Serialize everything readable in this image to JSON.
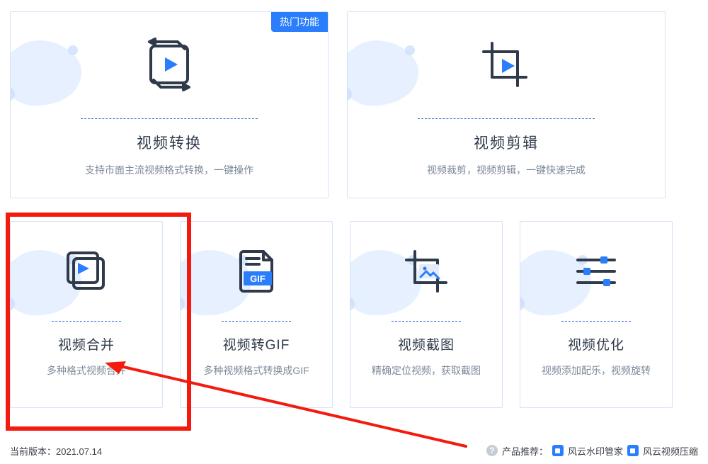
{
  "badge": {
    "hot": "热门功能"
  },
  "cards": {
    "video_convert": {
      "title": "视频转换",
      "subtitle": "支持市面主流视频格式转换，一键操作"
    },
    "video_edit": {
      "title": "视频剪辑",
      "subtitle": "视频裁剪，视频剪辑，一键快速完成"
    },
    "video_merge": {
      "title": "视频合并",
      "subtitle": "多种格式视频合并"
    },
    "video_to_gif": {
      "title": "视频转GIF",
      "subtitle": "多种视频格式转换成GIF",
      "gif_tag": "GIF"
    },
    "video_snapshot": {
      "title": "视频截图",
      "subtitle": "精确定位视频，获取截图"
    },
    "video_optimize": {
      "title": "视频优化",
      "subtitle": "视频添加配乐，视频旋转"
    }
  },
  "footer": {
    "version_label": "当前版本：",
    "version_value": "2021.07.14",
    "recommend_label": "产品推荐：",
    "rec1": "风云水印管家",
    "rec2": "风云视频压缩"
  }
}
